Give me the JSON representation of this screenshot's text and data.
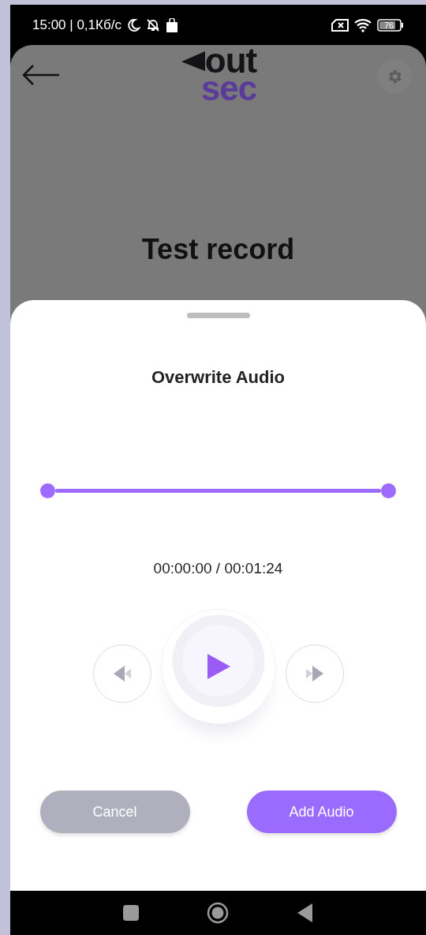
{
  "status_bar": {
    "time": "15:00 | 0,1Кб/с",
    "battery": "76"
  },
  "header": {
    "logo_top": "out",
    "logo_bottom": "sec",
    "title": "Test record"
  },
  "sheet": {
    "title": "Overwrite Audio",
    "range": {
      "thumbs": [
        {
          "level": 0
        },
        {
          "level": 1
        }
      ]
    },
    "time": "00:00:00 / 00:01:24",
    "playing": false,
    "buttons": [
      {
        "kind": "secondary",
        "label": "Cancel"
      },
      {
        "kind": "primary",
        "label": "Add Audio"
      }
    ]
  }
}
